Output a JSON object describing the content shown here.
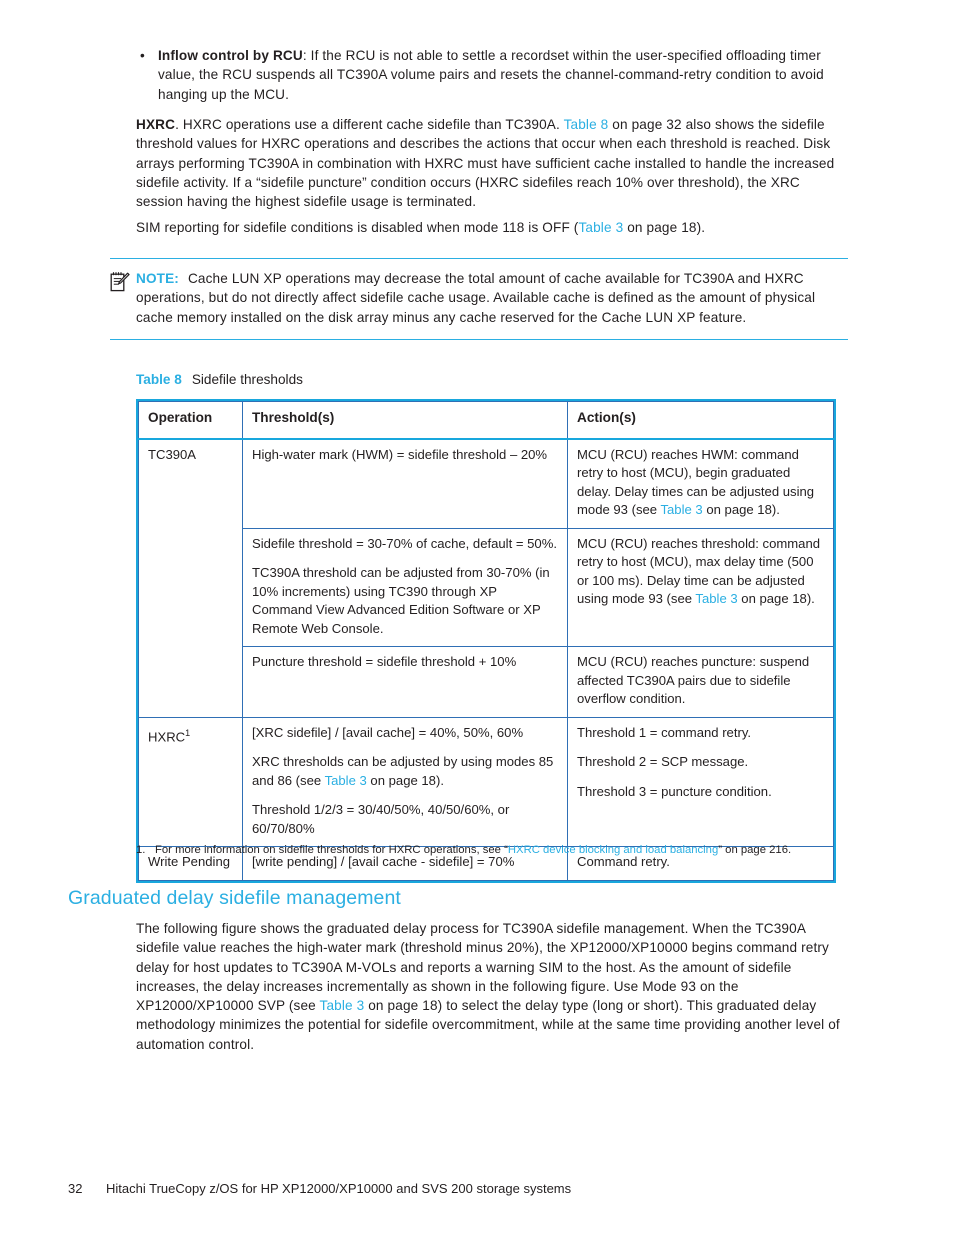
{
  "page": {
    "number": "32",
    "footer_title": "Hitachi TrueCopy z/OS for HP XP12000/XP10000 and SVS 200 storage systems"
  },
  "colors": {
    "accent_cyan": "#2bafe2",
    "table_outer_border": "#18a7dd",
    "table_inner_border": "#2f6fb5",
    "body_text": "#231f20"
  },
  "bullet": {
    "marker": "•",
    "lead_bold": "Inflow control by RCU",
    "text": ": If the RCU is not able to settle a recordset within the user-specified offloading timer value, the RCU suspends all TC390A volume pairs and resets the channel-command-retry condition to avoid hanging up the MCU."
  },
  "paragraphs": {
    "hxrc": {
      "lead_bold": "HXRC",
      "part1": ". HXRC operations use a different cache sidefile than TC390A. ",
      "link": "Table 8",
      "part2": " on page 32 also shows the sidefile threshold values for HXRC operations and describes the actions that occur when each threshold is reached. Disk arrays performing TC390A in combination with HXRC must have sufficient cache installed to handle the increased sidefile activity. If a “sidefile puncture” condition occurs (HXRC sidefiles reach 10% over threshold), the XRC session having the highest sidefile usage is terminated."
    },
    "sim": {
      "part1": "SIM reporting for sidefile conditions is disabled when mode 118 is OFF (",
      "link": "Table 3",
      "part2": " on page 18)."
    },
    "closing": {
      "part1": "The following figure shows the graduated delay process for TC390A sidefile management. When the TC390A sidefile value reaches the high-water mark (threshold minus 20%), the XP12000/XP10000 begins command retry delay for host updates to TC390A M-VOLs and reports a warning SIM to the host. As the amount of sidefile increases, the delay increases incrementally as shown in the following figure. Use Mode 93 on the XP12000/XP10000 SVP (see ",
      "link": "Table 3",
      "part2": " on page 18) to select the delay type (long or short). This graduated delay methodology minimizes the potential for sidefile overcommitment, while at the same time providing another level of automation control."
    }
  },
  "note": {
    "icon": "note-clipboard-icon",
    "label": "NOTE:",
    "text": "Cache LUN XP operations may decrease the total amount of cache available for TC390A and HXRC operations, but do not directly affect sidefile cache usage. Available cache is defined as the amount of physical cache memory installed on the disk array minus any cache reserved for the Cache LUN XP feature."
  },
  "table": {
    "caption_label": "Table 8",
    "caption_text": "Sidefile thresholds",
    "headers": [
      "Operation",
      "Threshold(s)",
      "Action(s)"
    ],
    "rows": [
      {
        "operation": "TC390A",
        "operation_sup": "",
        "rowspan": 3,
        "threshold_paragraphs": [
          "High-water mark (HWM) = sidefile threshold – 20%"
        ],
        "action_paragraphs_parts": [
          {
            "part1": "MCU (RCU) reaches HWM: command retry to host (MCU), begin graduated delay. Delay times can be adjusted using mode 93 (see ",
            "link": "Table 3",
            "part2": " on page 18)."
          }
        ]
      },
      {
        "operation": "",
        "threshold_paragraphs": [
          "Sidefile threshold = 30-70% of cache, default = 50%.",
          "TC390A threshold can be adjusted from 30-70% (in 10% increments) using TC390 through XP Command View Advanced Edition Software or XP Remote Web Console."
        ],
        "action_paragraphs_parts": [
          {
            "part1": "MCU (RCU) reaches threshold: command retry to host (MCU), max delay time (500 or 100 ms). Delay time can be adjusted using mode 93 (see ",
            "link": "Table 3",
            "part2": " on page 18)."
          }
        ]
      },
      {
        "operation": "",
        "threshold_paragraphs": [
          "Puncture threshold = sidefile threshold + 10%"
        ],
        "action_paragraphs_parts": [
          {
            "part1": "MCU (RCU) reaches puncture: suspend affected TC390A pairs due to sidefile overflow condition.",
            "link": "",
            "part2": ""
          }
        ]
      },
      {
        "operation": "HXRC",
        "operation_sup": "1",
        "rowspan": 1,
        "threshold_paragraphs": [
          "[XRC sidefile] / [avail cache] = 40%, 50%, 60%",
          "XRC thresholds can be adjusted by using modes 85 and 86 (see |LINK|Table 3|/LINK| on page 18).",
          "Threshold 1/2/3 = 30/40/50%, 40/50/60%, or 60/70/80%"
        ],
        "action_paragraphs": [
          "Threshold 1 = command retry.",
          "Threshold 2 = SCP message.",
          "Threshold 3 = puncture condition."
        ]
      },
      {
        "operation": "Write Pending",
        "operation_sup": "",
        "rowspan": 1,
        "threshold_paragraphs": [
          "[write pending] / [avail cache - sidefile] = 70%"
        ],
        "action_paragraphs": [
          "Command retry."
        ]
      }
    ]
  },
  "footnote": {
    "number": "1.",
    "part1": "For more information on sidefile thresholds for HXRC operations, see “",
    "link": "HXRC device blocking and load balancing",
    "part2": "” on page 216."
  },
  "section": {
    "heading": "Graduated delay sidefile management"
  }
}
